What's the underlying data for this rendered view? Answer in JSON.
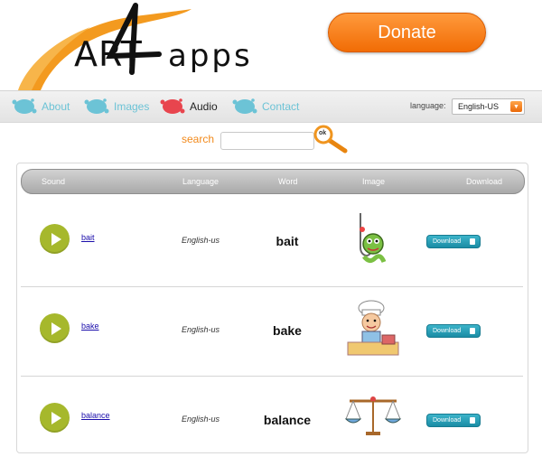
{
  "header": {
    "logo_art": "ART",
    "logo_apps": "apps",
    "donate_label": "Donate"
  },
  "nav": {
    "items": [
      {
        "label": "About"
      },
      {
        "label": "Images"
      },
      {
        "label": "Audio"
      },
      {
        "label": "Contact"
      }
    ],
    "language_label": "language:",
    "language_value": "English-US"
  },
  "search": {
    "label": "search",
    "value": "",
    "button_label": "ok"
  },
  "table": {
    "headers": [
      "Sound",
      "Language",
      "Word",
      "Image",
      "Download"
    ],
    "rows": [
      {
        "sound": "bait",
        "language": "English-us",
        "word": "bait",
        "download": "Download"
      },
      {
        "sound": "bake",
        "language": "English-us",
        "word": "bake",
        "download": "Download"
      },
      {
        "sound": "balance",
        "language": "English-us",
        "word": "balance",
        "download": "Download"
      }
    ]
  },
  "colors": {
    "accent_orange": "#f28a1c",
    "play_green": "#a6b82c",
    "download_teal": "#1a8ca5",
    "nav_blue": "#6cc3d6",
    "nav_red": "#e8454e"
  }
}
